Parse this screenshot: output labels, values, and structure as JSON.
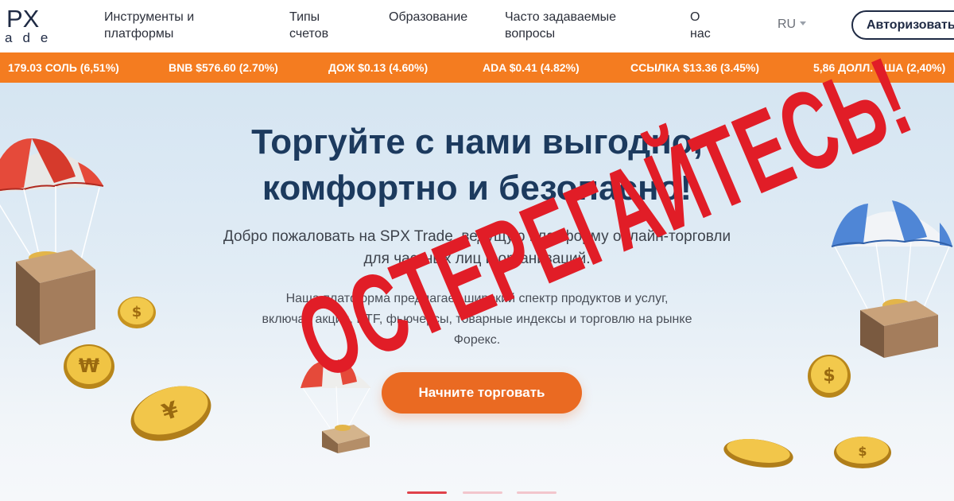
{
  "header": {
    "logo_top": "PX",
    "logo_bottom": "ade",
    "nav": [
      {
        "label_line1": "Инструменты и",
        "label_line2": "платформы"
      },
      {
        "label_line1": "Типы",
        "label_line2": "счетов"
      },
      {
        "label_line1": "Образование",
        "label_line2": ""
      },
      {
        "label_line1": "Часто задаваемые",
        "label_line2": "вопросы"
      },
      {
        "label_line1": "О",
        "label_line2": "нас"
      }
    ],
    "language": "RU",
    "login_label": "Авторизоваться"
  },
  "ticker": {
    "items": [
      "179.03 СОЛЬ (6,51%)",
      "BNB $576.60 (2.70%)",
      "ДОЖ $0.13 (4.60%)",
      "ADA $0.41 (4.82%)",
      "ССЫЛКА $13.36 (3.45%)",
      "5,86 ДОЛЛ. США (2,40%)"
    ]
  },
  "hero": {
    "headline_line1": "Торгуйте с нами выгодно,",
    "headline_line2": "комфортно и безопасно!",
    "subtitle_line1": "Добро пожаловать на SPX Trade, ведущую платформу онлайн-торговли",
    "subtitle_line2": "для частных лиц и организаций.",
    "desc_line1": "Наша платформа предлагает широкий спектр продуктов и услуг,",
    "desc_line2": "включая акции, ETF, фьючерсы, товарные индексы и торговлю на рынке",
    "desc_line3": "Форекс.",
    "cta_label": "Начните торговать",
    "slider_active": 1,
    "slider_count": 3
  },
  "stamp": {
    "text": "ОСТЕРЕГАЙТЕСЬ!",
    "color": "#e11d27"
  },
  "colors": {
    "accent": "#f47c20",
    "cta": "#ea6a22",
    "headline": "#1c3a5e",
    "brand_dark": "#1f2a44"
  },
  "icons": [
    "parachute-box-icon",
    "coin-icon",
    "caret-down-icon"
  ]
}
